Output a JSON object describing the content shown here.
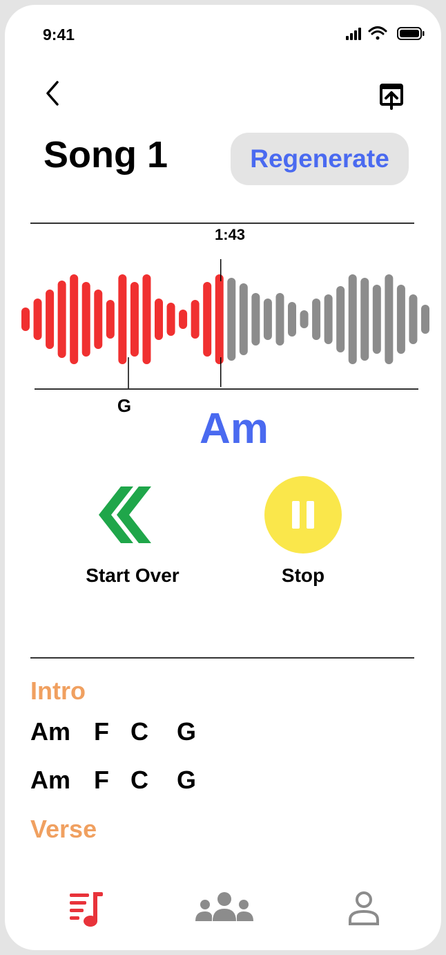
{
  "status_bar": {
    "time": "9:41"
  },
  "header": {
    "title": "Song 1",
    "regenerate_label": "Regenerate"
  },
  "player": {
    "playhead_time": "1:43",
    "previous_chord": "G",
    "current_chord": "Am",
    "progress_fraction": 0.49
  },
  "controls": {
    "start_over_label": "Start Over",
    "stop_label": "Stop"
  },
  "sections": [
    {
      "label": "Intro",
      "rows": [
        [
          "Am",
          "F",
          "C",
          "G"
        ],
        [
          "Am",
          "F",
          "C",
          "G"
        ]
      ]
    },
    {
      "label": "Verse",
      "rows": []
    }
  ],
  "bottom_nav": [
    {
      "icon": "song-chords-icon",
      "active": true
    },
    {
      "icon": "group-icon",
      "active": false
    },
    {
      "icon": "profile-icon",
      "active": false
    }
  ],
  "colors": {
    "played": "#f03030",
    "unplayed": "#8c8c8c",
    "accent_blue": "#4a6af0",
    "section_orange": "#f0a060",
    "start_over_green": "#1fa64a",
    "stop_yellow": "#fae74b",
    "nav_active": "#e8333a",
    "nav_inactive": "#8c8c8c"
  }
}
